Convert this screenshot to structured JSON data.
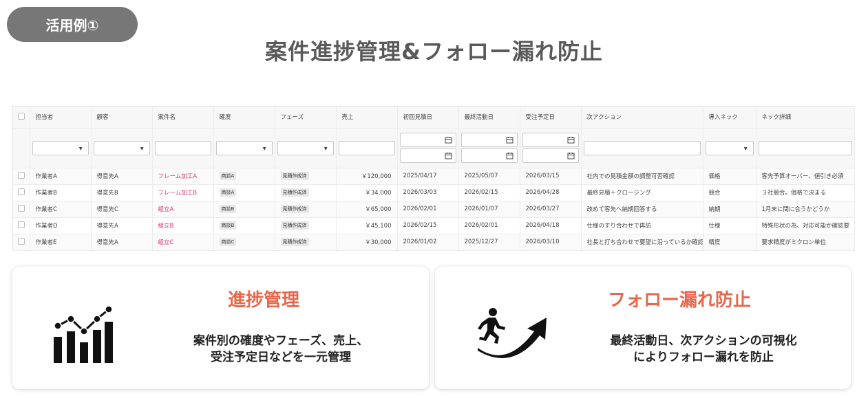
{
  "badge": "活用例①",
  "title": "案件進捗管理&フォロー漏れ防止",
  "table": {
    "columns": [
      "担当者",
      "顧客",
      "案件名",
      "確度",
      "フェーズ",
      "売上",
      "初回見積日",
      "最終活動日",
      "受注予定日",
      "次アクション",
      "導入ネック",
      "ネック詳細"
    ],
    "rows": [
      {
        "owner": "作業者A",
        "customer": "得意先A",
        "project": "フレーム加工A",
        "certainty": "商談A",
        "phase": "見積作成済",
        "sales": "￥120,000",
        "first_quote": "2025/04/17",
        "last_activity": "2025/05/07",
        "order_planned": "2026/03/15",
        "next_action": "社内での見積金額の調整可否確認",
        "neck": "価格",
        "neck_detail": "客先予算オーバー、値引き必須"
      },
      {
        "owner": "作業者B",
        "customer": "得意先B",
        "project": "フレーム加工B",
        "certainty": "商談A",
        "phase": "見積作成済",
        "sales": "￥34,000",
        "first_quote": "2026/03/03",
        "last_activity": "2026/02/15",
        "order_planned": "2026/04/28",
        "next_action": "最終見積＋クロージング",
        "neck": "競合",
        "neck_detail": "３社競合。価格で決まる"
      },
      {
        "owner": "作業者C",
        "customer": "得意先C",
        "project": "組立A",
        "certainty": "商談B",
        "phase": "見積作成済",
        "sales": "￥65,000",
        "first_quote": "2026/02/01",
        "last_activity": "2026/01/07",
        "order_planned": "2026/03/27",
        "next_action": "改めて客先へ納期回答する",
        "neck": "納期",
        "neck_detail": "1月末に間に合うかどうか"
      },
      {
        "owner": "作業者D",
        "customer": "得意先A",
        "project": "組立B",
        "certainty": "商談B",
        "phase": "見積作成済",
        "sales": "￥45,100",
        "first_quote": "2026/02/15",
        "last_activity": "2026/02/01",
        "order_planned": "2026/04/18",
        "next_action": "仕様のすり合わせで再訪",
        "neck": "仕様",
        "neck_detail": "特殊形状の為、対応可能か確認要"
      },
      {
        "owner": "作業者E",
        "customer": "得意先A",
        "project": "組立C",
        "certainty": "商談C",
        "phase": "見積作成済",
        "sales": "￥30,000",
        "first_quote": "2026/01/02",
        "last_activity": "2025/12/27",
        "order_planned": "2026/03/10",
        "next_action": "社長と打ち合わせで要望に沿っているか確認",
        "neck": "精度",
        "neck_detail": "要求精度がミクロン単位"
      }
    ]
  },
  "cards": [
    {
      "title": "進捗管理",
      "desc_line1": "案件別の確度やフェーズ、売上、",
      "desc_line2": "受注予定日などを一元管理",
      "icon": "bar-line-chart-icon"
    },
    {
      "title": "フォロー漏れ防止",
      "desc_line1": "最終活動日、次アクションの可視化",
      "desc_line2": "によりフォロー漏れを防止",
      "icon": "running-person-arrow-icon"
    }
  ],
  "colors": {
    "accent": "#e8664a",
    "badge": "#777777",
    "link": "#d83a6a",
    "title": "#595959"
  }
}
